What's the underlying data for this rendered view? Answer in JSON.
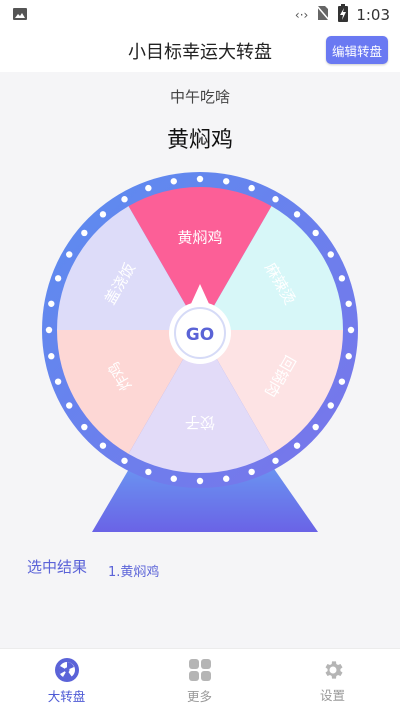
{
  "status_bar": {
    "time": "1:03",
    "image_icon": "image-icon",
    "signal_icon": "code-icon",
    "nosim_icon": "no-sim-icon",
    "battery_icon": "battery-charging-icon"
  },
  "app_bar": {
    "title": "小目标幸运大转盘",
    "edit_button": "编辑转盘"
  },
  "question": "中午吃啥",
  "result": "黄焖鸡",
  "wheel": {
    "center_button": "GO",
    "segments": [
      {
        "label": "黄焖鸡",
        "color": "#fc5f97"
      },
      {
        "label": "麻辣烫",
        "color": "#d7f7f8"
      },
      {
        "label": "回锅肉",
        "color": "#fde3e4"
      },
      {
        "label": "饺子",
        "color": "#e2dbf8"
      },
      {
        "label": "炸鸡",
        "color": "#fdd7d5"
      },
      {
        "label": "盖浇饭",
        "color": "#dddcf9"
      }
    ],
    "ring_color": "#6a82ee",
    "stand_color": "#5b6fe8"
  },
  "results": {
    "label": "选中结果",
    "items": [
      "1.黄焖鸡"
    ]
  },
  "tabs": [
    {
      "label": "大转盘",
      "icon": "wheel-icon",
      "active": true
    },
    {
      "label": "更多",
      "icon": "grid-icon",
      "active": false
    },
    {
      "label": "设置",
      "icon": "gear-icon",
      "active": false
    }
  ]
}
